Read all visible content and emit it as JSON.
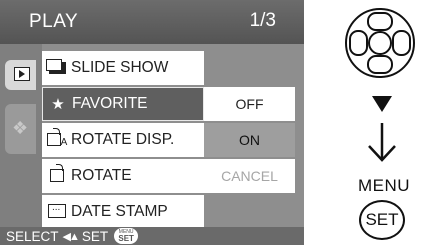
{
  "screen": {
    "title": "PLAY",
    "page_indicator": "1/3",
    "tabs": [
      {
        "name": "play-tab",
        "icon": "play-icon"
      },
      {
        "name": "setup-tab",
        "icon": "wrench-icon"
      }
    ],
    "menu_items": [
      {
        "label": "SLIDE SHOW",
        "icon": "slideshow-icon"
      },
      {
        "label": "FAVORITE",
        "icon": "star-icon",
        "icon_glyph": "★",
        "selected": true
      },
      {
        "label": "ROTATE DISP.",
        "icon": "rotate-display-icon"
      },
      {
        "label": "ROTATE",
        "icon": "rotate-icon"
      },
      {
        "label": "DATE STAMP",
        "icon": "date-stamp-icon"
      }
    ],
    "submenu": [
      {
        "label": "OFF"
      },
      {
        "label": "ON",
        "highlight": true
      },
      {
        "label": "CANCEL",
        "dim": true
      }
    ],
    "bottom_bar": {
      "select_label": "SELECT",
      "set_label": "SET",
      "chip_top": "MENU",
      "chip_main": "SET"
    }
  },
  "instruction": {
    "menu_label": "MENU",
    "set_button_label": "SET"
  },
  "colors": {
    "title_bar": "#5e5e5e",
    "screen_bg": "#8e8e8e",
    "selected_item": "#5f5f5f",
    "highlight_option": "#9e9e9e"
  }
}
